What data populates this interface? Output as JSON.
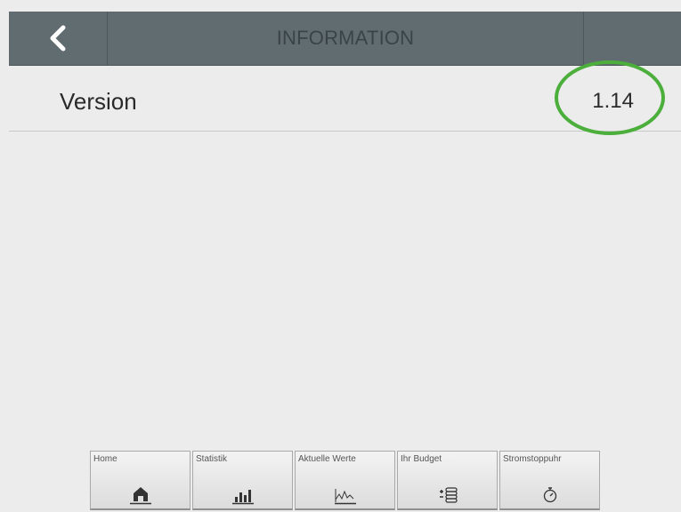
{
  "header": {
    "title": "INFORMATION",
    "back_icon": "chevron-left-icon"
  },
  "info": {
    "version_label": "Version",
    "version_value": "1.14"
  },
  "annotation": {
    "color": "#4caf3c"
  },
  "bottom_nav": [
    {
      "label": "Home",
      "icon": "house-icon"
    },
    {
      "label": "Statistik",
      "icon": "bar-chart-icon"
    },
    {
      "label": "Aktuelle Werte",
      "icon": "line-chart-icon"
    },
    {
      "label": "Ihr Budget",
      "icon": "coin-stack-icon"
    },
    {
      "label": "Stromstoppuhr",
      "icon": "stopwatch-icon"
    }
  ],
  "colors": {
    "header_bg": "#606c70",
    "page_bg": "#ececec",
    "icon_dark": "#333333"
  }
}
